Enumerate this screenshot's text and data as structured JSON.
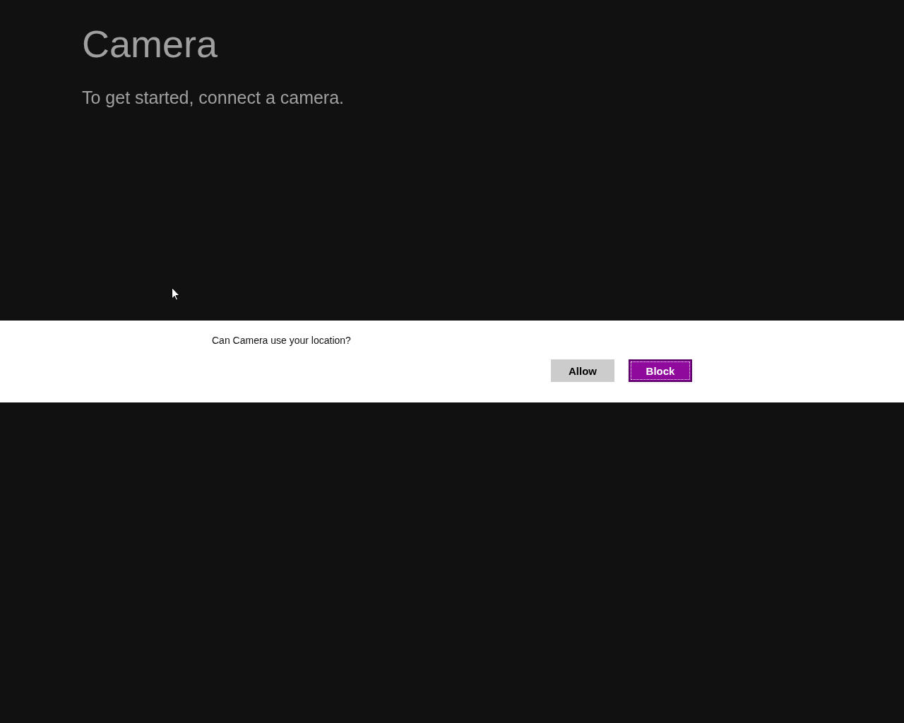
{
  "app": {
    "title": "Camera",
    "message": "To get started, connect a camera."
  },
  "dialog": {
    "message": "Can Camera use your location?",
    "buttons": [
      {
        "label": "Allow",
        "focused": false
      },
      {
        "label": "Block",
        "focused": true
      }
    ]
  }
}
